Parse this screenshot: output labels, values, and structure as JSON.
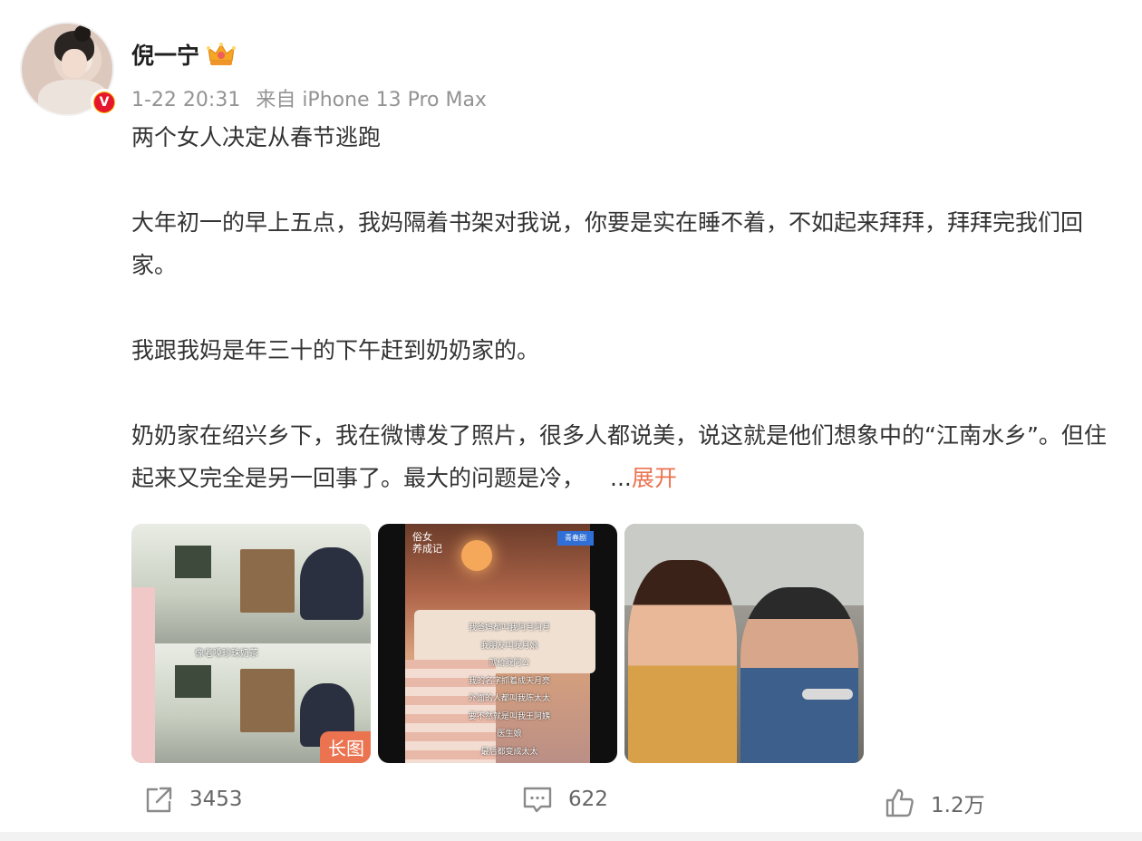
{
  "user": {
    "name": "倪一宁",
    "verified_badge": "V",
    "crown_icon": "crown-icon"
  },
  "meta": {
    "time": "1-22 20:31",
    "source": "来自 iPhone 13 Pro Max"
  },
  "post": {
    "paragraphs": [
      "两个女人决定从春节逃跑",
      "大年初一的早上五点，我妈隔着书架对我说，你要是实在睡不着，不如起来拜拜，拜拜完我们回家。",
      "我跟我妈是年三十的下午赶到奶奶家的。"
    ],
    "last_paragraph": "奶奶家在绍兴乡下，我在微博发了照片，很多人都说美，说这就是他们想象中的“江南水乡”。但住起来又完全是另一回事了。最大的问题是冷，",
    "ellipsis": "...",
    "expand_label": "展开"
  },
  "images": {
    "image1": {
      "caption": "像老嗓珍珠奶茶",
      "tag": "长图"
    },
    "image2": {
      "logo": "俗女\n养成记",
      "tag": "青春剧",
      "subtitles": [
        "我爸妈都叫我阿月阿月",
        "我朋友叫我月娘",
        "就给我阿公",
        "我的名字抓着成天月亮",
        "外面的人都叫我陈太太",
        "要不然就是叫我王阿姨",
        "医生娘",
        "最后都变成太太",
        "也有人叫我陈妈妈"
      ]
    },
    "image3": {}
  },
  "actions": {
    "repost_count": "3453",
    "comment_count": "622",
    "like_count": "1.2万"
  },
  "colors": {
    "accent": "#eb7350",
    "meta": "#939393",
    "text": "#333333",
    "verified": "#e6162d"
  }
}
